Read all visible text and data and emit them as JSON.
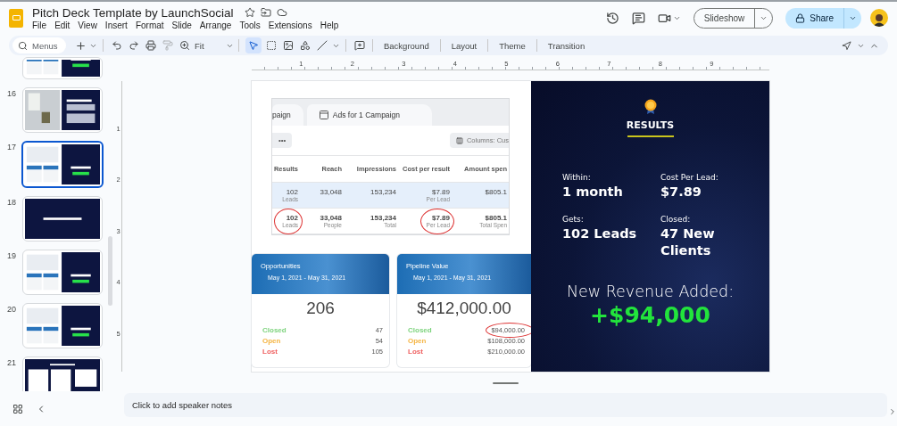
{
  "app": {
    "title": "Pitch Deck Template by LaunchSocial",
    "menu": [
      "File",
      "Edit",
      "View",
      "Insert",
      "Format",
      "Slide",
      "Arrange",
      "Tools",
      "Extensions",
      "Help"
    ]
  },
  "header_actions": {
    "slideshow": "Slideshow",
    "share": "Share"
  },
  "toolbar": {
    "search_placeholder": "Menus",
    "zoom": "Fit",
    "buttons": [
      "Background",
      "Layout",
      "Theme",
      "Transition"
    ]
  },
  "ruler": [
    "1",
    "2",
    "3",
    "4",
    "5",
    "6",
    "7",
    "8",
    "9"
  ],
  "vertical_ruler": [
    "1",
    "2",
    "3",
    "4",
    "5"
  ],
  "slides": [
    {
      "kind": "split",
      "selected": false
    },
    {
      "number": "16",
      "selected": false
    },
    {
      "number": "17",
      "kind": "split",
      "selected": true
    },
    {
      "number": "18",
      "kind": "title",
      "selected": false
    },
    {
      "number": "19",
      "kind": "split",
      "selected": false
    },
    {
      "number": "20",
      "kind": "split",
      "selected": false
    },
    {
      "number": "21",
      "kind": "tables",
      "selected": false
    }
  ],
  "slide": {
    "screenshot": {
      "tabs": [
        "paign",
        "Ads for 1 Campaign"
      ],
      "more": "•••",
      "columns_button": "Columns: Cus",
      "columns": [
        "Results",
        "Reach",
        "Impressions",
        "Cost per result",
        "Amount spen"
      ],
      "rows": [
        {
          "selected": true,
          "cells": [
            {
              "value": "102",
              "sub": "Leads",
              "circled": false
            },
            {
              "value": "33,048",
              "circled": false
            },
            {
              "value": "153,234",
              "circled": false
            },
            {
              "value": "$7.89",
              "sub": "Per Lead",
              "circled": false
            },
            {
              "value": "$805.1",
              "circled": false
            }
          ]
        },
        {
          "selected": false,
          "cells": [
            {
              "value": "102",
              "sub": "Leads",
              "circled": true
            },
            {
              "value": "33,048",
              "sub": "People",
              "circled": false
            },
            {
              "value": "153,234",
              "sub": "Total",
              "circled": false
            },
            {
              "value": "$7.89",
              "sub": "Per Lead",
              "circled": true
            },
            {
              "value": "$805.1",
              "sub": "Total Spen",
              "circled": false
            }
          ]
        }
      ]
    },
    "cards": [
      {
        "title": "Opportunities",
        "dates": "May 1, 2021 - May 31, 2021",
        "total": "206",
        "lines": [
          {
            "label": "Closed",
            "value": "47",
            "color": "#7dd37d",
            "circled": false
          },
          {
            "label": "Open",
            "value": "54",
            "color": "#f5b544",
            "circled": false
          },
          {
            "label": "Lost",
            "value": "105",
            "color": "#ef6060",
            "circled": false
          }
        ]
      },
      {
        "title": "Pipeline Value",
        "dates": "May 1, 2021 - May 31, 2021",
        "total": "$412,000.00",
        "lines": [
          {
            "label": "Closed",
            "value": "$94,000.00",
            "color": "#7dd37d",
            "circled": true
          },
          {
            "label": "Open",
            "value": "$108,000.00",
            "color": "#f5b544",
            "circled": false
          },
          {
            "label": "Lost",
            "value": "$210,000.00",
            "color": "#ef6060",
            "circled": false
          }
        ]
      }
    ],
    "results": {
      "title": "RESULTS",
      "stats": [
        {
          "label": "Within:",
          "value": "1 month"
        },
        {
          "label": "Cost Per Lead:",
          "value": "$7.89"
        },
        {
          "label": "Gets:",
          "value": "102 Leads"
        },
        {
          "label": "Closed:",
          "value": "47 New Clients"
        }
      ],
      "revenue_label": "New Revenue Added:",
      "revenue": "+$94,000"
    }
  },
  "notes": {
    "placeholder": "Click to add speaker notes"
  }
}
